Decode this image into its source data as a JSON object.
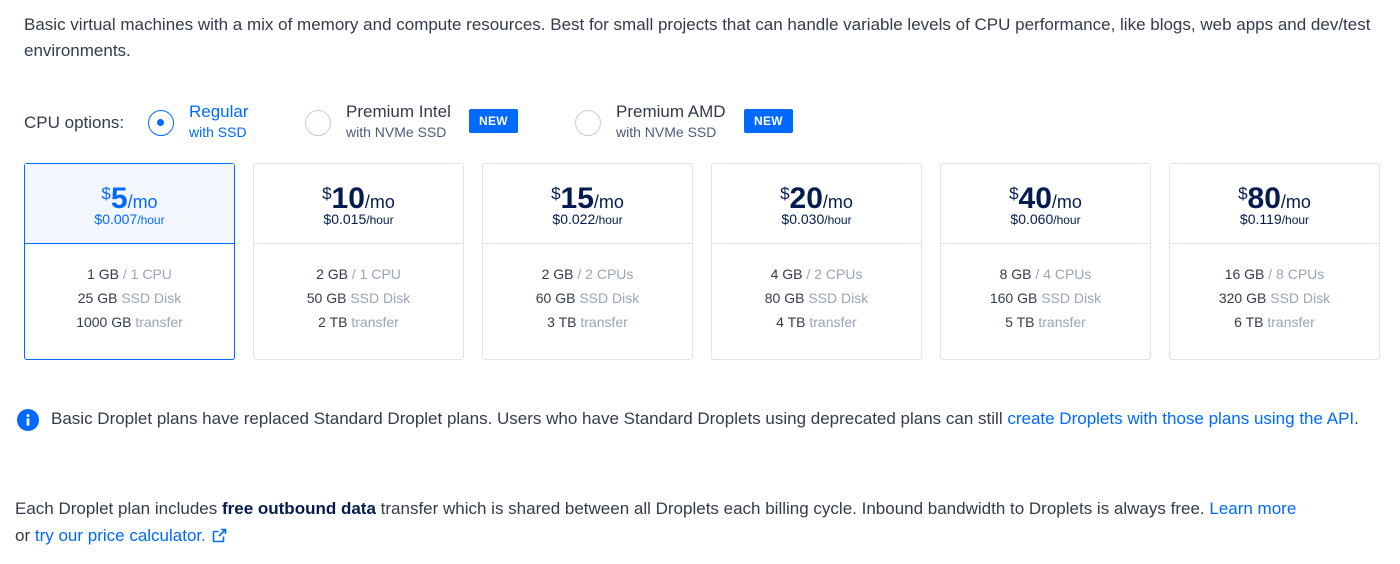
{
  "intro": "Basic virtual machines with a mix of memory and compute resources. Best for small projects that can handle variable levels of CPU performance, like blogs, web apps and dev/test environments.",
  "cpu_options": {
    "label": "CPU options:",
    "options": [
      {
        "title": "Regular",
        "subtitle": "with SSD",
        "selected": true
      },
      {
        "title": "Premium Intel",
        "subtitle": "with NVMe SSD",
        "badge": "NEW",
        "selected": false
      },
      {
        "title": "Premium AMD",
        "subtitle": "with NVMe SSD",
        "badge": "NEW",
        "selected": false
      }
    ]
  },
  "plans": [
    {
      "currency": "$",
      "price": "5",
      "period": "/mo",
      "hourly": "$0.007",
      "hour_unit": "/hour",
      "memory": "1 GB",
      "cpu": "/ 1 CPU",
      "disk": "25 GB",
      "disk_label": "SSD Disk",
      "transfer": "1000 GB",
      "transfer_label": "transfer",
      "selected": true
    },
    {
      "currency": "$",
      "price": "10",
      "period": "/mo",
      "hourly": "$0.015",
      "hour_unit": "/hour",
      "memory": "2 GB",
      "cpu": "/ 1 CPU",
      "disk": "50 GB",
      "disk_label": "SSD Disk",
      "transfer": "2 TB",
      "transfer_label": "transfer",
      "selected": false
    },
    {
      "currency": "$",
      "price": "15",
      "period": "/mo",
      "hourly": "$0.022",
      "hour_unit": "/hour",
      "memory": "2 GB",
      "cpu": "/ 2 CPUs",
      "disk": "60 GB",
      "disk_label": "SSD Disk",
      "transfer": "3 TB",
      "transfer_label": "transfer",
      "selected": false
    },
    {
      "currency": "$",
      "price": "20",
      "period": "/mo",
      "hourly": "$0.030",
      "hour_unit": "/hour",
      "memory": "4 GB",
      "cpu": "/ 2 CPUs",
      "disk": "80 GB",
      "disk_label": "SSD Disk",
      "transfer": "4 TB",
      "transfer_label": "transfer",
      "selected": false
    },
    {
      "currency": "$",
      "price": "40",
      "period": "/mo",
      "hourly": "$0.060",
      "hour_unit": "/hour",
      "memory": "8 GB",
      "cpu": "/ 4 CPUs",
      "disk": "160 GB",
      "disk_label": "SSD Disk",
      "transfer": "5 TB",
      "transfer_label": "transfer",
      "selected": false
    },
    {
      "currency": "$",
      "price": "80",
      "period": "/mo",
      "hourly": "$0.119",
      "hour_unit": "/hour",
      "memory": "16 GB",
      "cpu": "/ 8 CPUs",
      "disk": "320 GB",
      "disk_label": "SSD Disk",
      "transfer": "6 TB",
      "transfer_label": "transfer",
      "selected": false
    }
  ],
  "info": {
    "icon": "info-icon",
    "text": "Basic Droplet plans have replaced Standard Droplet plans. Users who have Standard Droplets using deprecated plans can still ",
    "link": "create Droplets with those plans using the API",
    "suffix": "."
  },
  "footer": {
    "text1": "Each Droplet plan includes ",
    "bold": "free outbound data",
    "text2": " transfer which is shared between all Droplets each billing cycle. Inbound bandwidth to Droplets is always free. ",
    "link1": "Learn more",
    "text3": " or ",
    "link2": "try our price calculator.",
    "icon": "external-link-icon"
  },
  "colors": {
    "accent": "#0069ff",
    "text": "#333b4a",
    "muted": "#9ba5b7",
    "border": "#dfe3ea"
  }
}
